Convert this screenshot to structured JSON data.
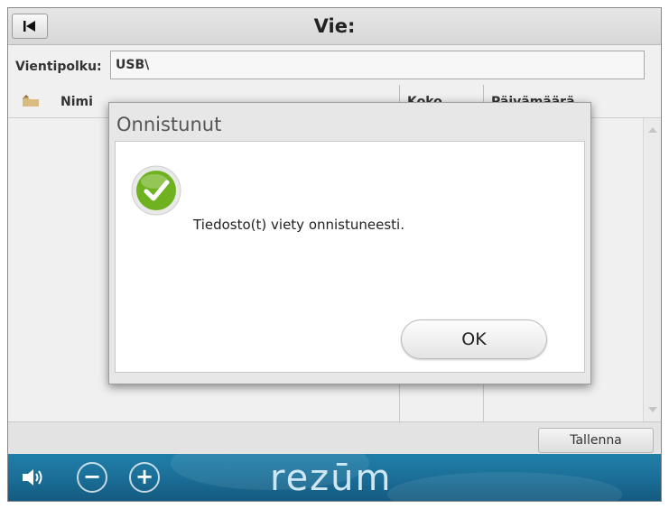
{
  "header": {
    "title": "Vie:",
    "back_icon": "back-to-start-icon"
  },
  "path": {
    "label": "Vientipolku:",
    "value": "USB\\"
  },
  "table": {
    "columns": [
      "Nimi",
      "Koko",
      "Päivämäärä"
    ],
    "rows": []
  },
  "footer": {
    "save_label": "Tallenna"
  },
  "bottom_bar": {
    "brand": "rezūm",
    "volume_icon": "speaker-icon",
    "minus": "−",
    "plus": "+"
  },
  "dialog": {
    "title": "Onnistunut",
    "message": "Tiedosto(t) viety onnistuneesti.",
    "ok_label": "OK",
    "status_icon": "success-check-icon",
    "accent": "#6fb21f"
  }
}
